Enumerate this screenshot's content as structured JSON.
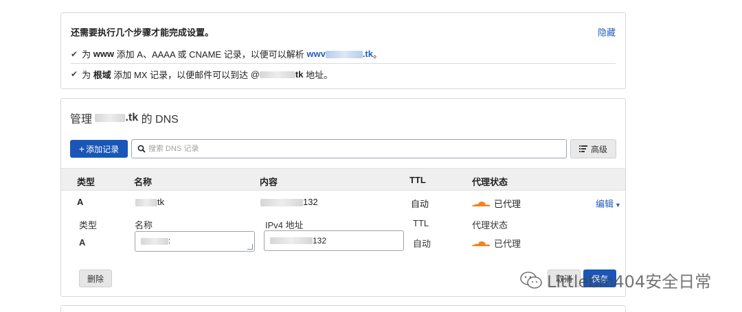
{
  "setup": {
    "title": "还需要执行几个步骤才能完成设置。",
    "hide_label": "隐藏",
    "item1": {
      "prefix": "为",
      "www": "www",
      "text": "添加 A、AAAA 或 CNAME 记录，以便可以解析",
      "domain_start": "wwv",
      "domain_end": ".tk",
      "suffix": "。"
    },
    "item2": {
      "prefix": "为",
      "root": "根域",
      "text": "添加 MX 记录，以便邮件可以到达",
      "at": "@",
      "tk": "tk",
      "suffix": "地址。"
    }
  },
  "dns": {
    "title_prefix": "管理",
    "title_domain": ".tk",
    "title_suffix": "的 DNS",
    "add_record_label": "添加记录",
    "search_placeholder": "搜索 DNS 记录",
    "advanced_label": "高级",
    "columns": {
      "type": "类型",
      "name": "名称",
      "content": "内容",
      "ttl": "TTL",
      "proxy": "代理状态"
    },
    "record": {
      "type": "A",
      "name_suffix": "tk",
      "content_suffix": "132",
      "ttl": "自动",
      "proxy": "已代理",
      "edit_label": "编辑"
    },
    "edit_form": {
      "type_label": "类型",
      "type_value": "A",
      "name_label": "名称",
      "name_suffix": ":",
      "content_label": "IPv4 地址",
      "content_suffix": "132",
      "ttl_label": "TTL",
      "ttl_value": "自动",
      "proxy_label": "代理状态",
      "proxy_value": "已代理",
      "delete_label": "删除",
      "cancel_label": "取消",
      "save_label": "保存"
    }
  },
  "watermark": {
    "text": "Littlebin404安全日常"
  },
  "colors": {
    "primary": "#1a56b8",
    "link": "#1f5fbf",
    "cloud": "#f48120"
  }
}
